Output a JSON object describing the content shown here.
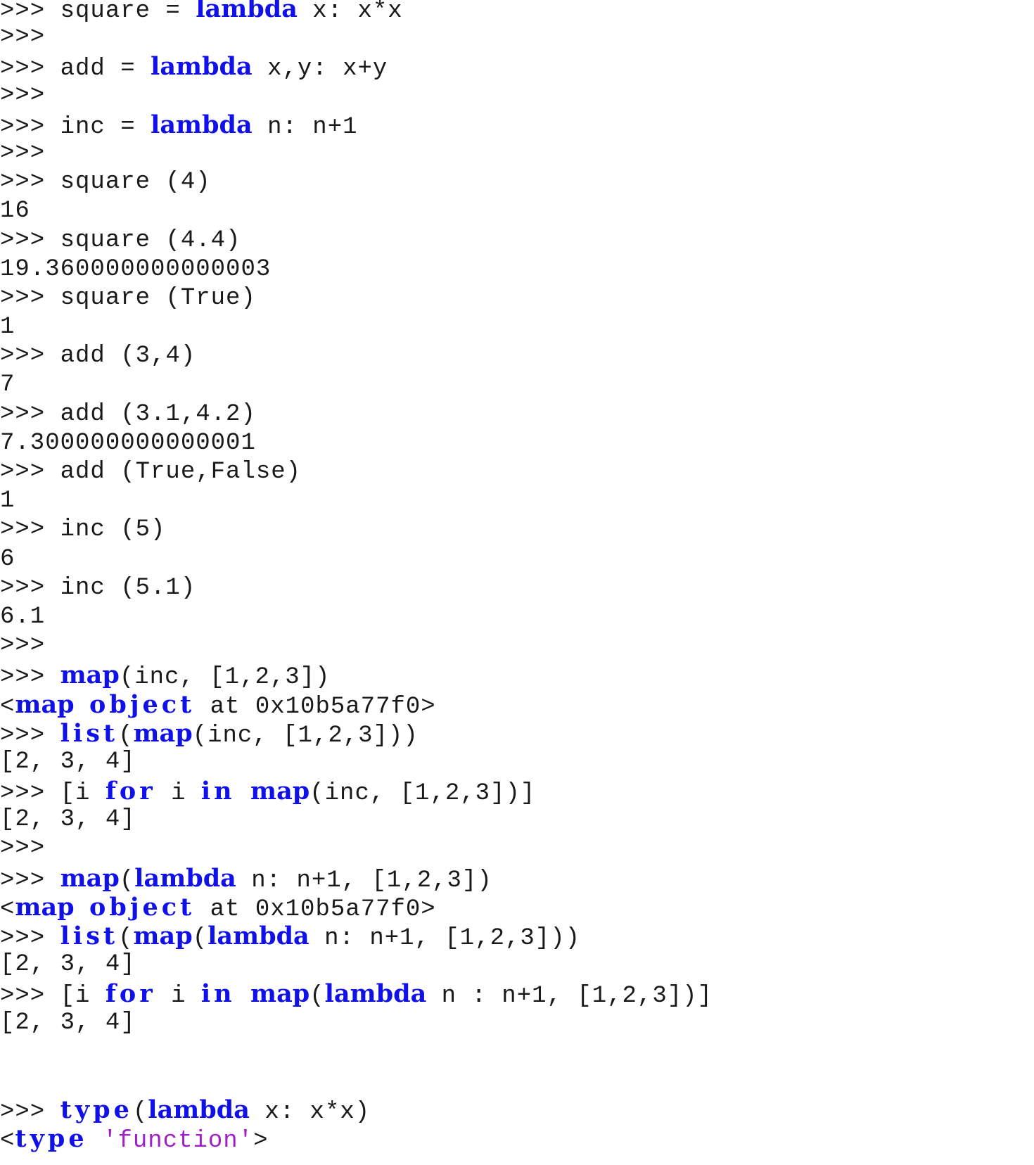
{
  "colors": {
    "keyword": "#1010e8",
    "string": "#a020c8",
    "text": "#1a1a1a",
    "background": "#ffffff"
  },
  "lines": [
    [
      {
        "t": ">>> square = "
      },
      {
        "t": "lambda",
        "k": "kw"
      },
      {
        "t": " x: x*x"
      }
    ],
    [
      {
        "t": ">>>"
      }
    ],
    [
      {
        "t": ">>> add = "
      },
      {
        "t": "lambda",
        "k": "kw"
      },
      {
        "t": " x,y: x+y"
      }
    ],
    [
      {
        "t": ">>>"
      }
    ],
    [
      {
        "t": ">>> inc = "
      },
      {
        "t": "lambda",
        "k": "kw"
      },
      {
        "t": " n: n+1"
      }
    ],
    [
      {
        "t": ">>>"
      }
    ],
    [
      {
        "t": ">>> square (4)"
      }
    ],
    [
      {
        "t": "16"
      }
    ],
    [
      {
        "t": ">>> square (4.4)"
      }
    ],
    [
      {
        "t": "19.360000000000003"
      }
    ],
    [
      {
        "t": ">>> square (True)"
      }
    ],
    [
      {
        "t": "1"
      }
    ],
    [
      {
        "t": ">>> add (3,4)"
      }
    ],
    [
      {
        "t": "7"
      }
    ],
    [
      {
        "t": ">>> add (3.1,4.2)"
      }
    ],
    [
      {
        "t": "7.300000000000001"
      }
    ],
    [
      {
        "t": ">>> add (True,False)"
      }
    ],
    [
      {
        "t": "1"
      }
    ],
    [
      {
        "t": ">>> inc (5)"
      }
    ],
    [
      {
        "t": "6"
      }
    ],
    [
      {
        "t": ">>> inc (5.1)"
      }
    ],
    [
      {
        "t": "6.1"
      }
    ],
    [
      {
        "t": ">>>"
      }
    ],
    [
      {
        "t": ">>> "
      },
      {
        "t": "map",
        "k": "kw"
      },
      {
        "t": "(inc, [1,2,3])"
      }
    ],
    [
      {
        "t": "<"
      },
      {
        "t": "map",
        "k": "kw"
      },
      {
        "t": " "
      },
      {
        "t": "object",
        "k": "kw spaced"
      },
      {
        "t": " at 0x10b5a77f0>"
      }
    ],
    [
      {
        "t": ">>> "
      },
      {
        "t": "list",
        "k": "kw spaced"
      },
      {
        "t": "("
      },
      {
        "t": "map",
        "k": "kw"
      },
      {
        "t": "(inc, [1,2,3]))"
      }
    ],
    [
      {
        "t": "[2, 3, 4]"
      }
    ],
    [
      {
        "t": ">>> [i "
      },
      {
        "t": "for",
        "k": "kw spaced"
      },
      {
        "t": " i "
      },
      {
        "t": "in",
        "k": "kw spaced"
      },
      {
        "t": " "
      },
      {
        "t": "map",
        "k": "kw"
      },
      {
        "t": "(inc, [1,2,3])]"
      }
    ],
    [
      {
        "t": "[2, 3, 4]"
      }
    ],
    [
      {
        "t": ">>>"
      }
    ],
    [
      {
        "t": ">>> "
      },
      {
        "t": "map",
        "k": "kw"
      },
      {
        "t": "("
      },
      {
        "t": "lambda",
        "k": "kw"
      },
      {
        "t": " n: n+1, [1,2,3])"
      }
    ],
    [
      {
        "t": "<"
      },
      {
        "t": "map",
        "k": "kw"
      },
      {
        "t": " "
      },
      {
        "t": "object",
        "k": "kw spaced"
      },
      {
        "t": " at 0x10b5a77f0>"
      }
    ],
    [
      {
        "t": ">>> "
      },
      {
        "t": "list",
        "k": "kw spaced"
      },
      {
        "t": "("
      },
      {
        "t": "map",
        "k": "kw"
      },
      {
        "t": "("
      },
      {
        "t": "lambda",
        "k": "kw"
      },
      {
        "t": " n: n+1, [1,2,3]))"
      }
    ],
    [
      {
        "t": "[2, 3, 4]"
      }
    ],
    [
      {
        "t": ">>> [i "
      },
      {
        "t": "for",
        "k": "kw spaced"
      },
      {
        "t": " i "
      },
      {
        "t": "in",
        "k": "kw spaced"
      },
      {
        "t": " "
      },
      {
        "t": "map",
        "k": "kw"
      },
      {
        "t": "("
      },
      {
        "t": "lambda",
        "k": "kw"
      },
      {
        "t": " n : n+1, [1,2,3])]"
      }
    ],
    [
      {
        "t": "[2, 3, 4]"
      }
    ],
    [],
    [
      {
        "t": ">>> "
      },
      {
        "t": "type",
        "k": "kw spaced"
      },
      {
        "t": "("
      },
      {
        "t": "lambda",
        "k": "kw"
      },
      {
        "t": " x: x*x)"
      }
    ],
    [
      {
        "t": "<"
      },
      {
        "t": "type",
        "k": "kw spaced"
      },
      {
        "t": " "
      },
      {
        "t": "'function'",
        "k": "str"
      },
      {
        "t": ">"
      }
    ]
  ]
}
